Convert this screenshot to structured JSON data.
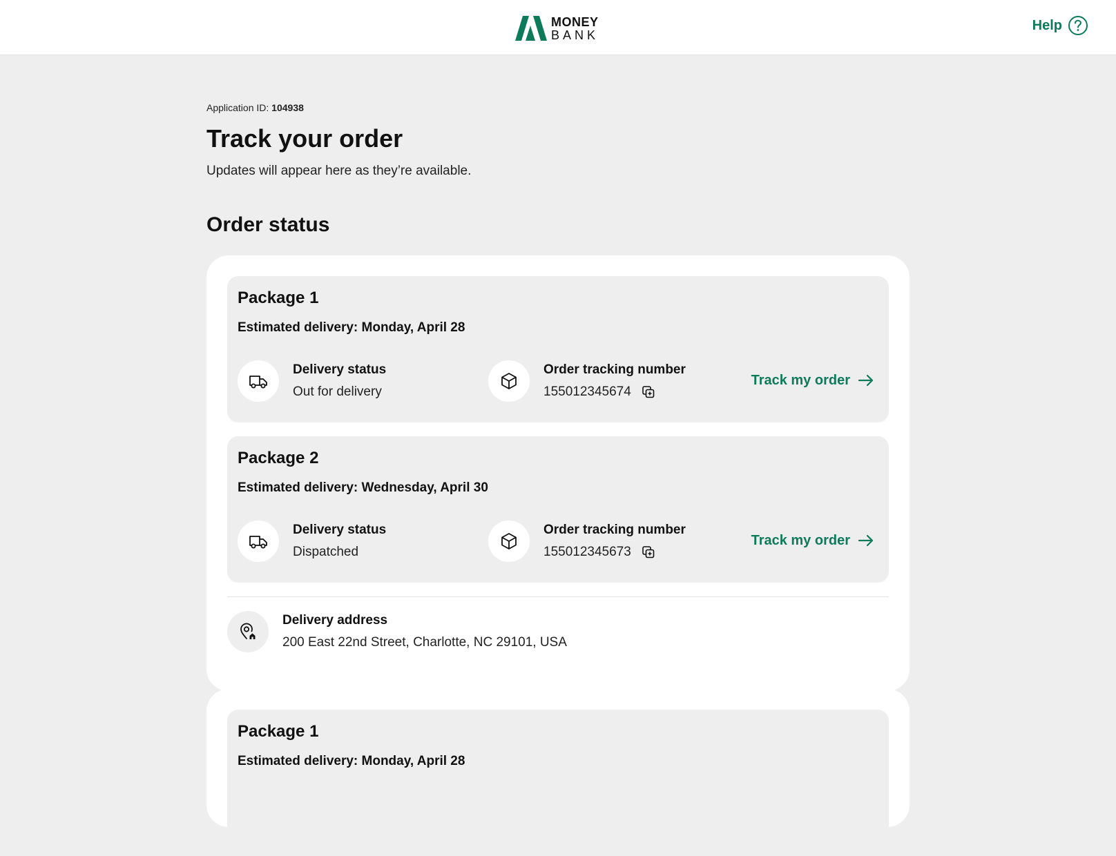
{
  "header": {
    "logo_line1": "MONEY",
    "logo_line2": "BANK",
    "help_label": "Help",
    "help_icon": "question-circle-icon",
    "brand_color": "#0d7a5a"
  },
  "application": {
    "id_label": "Application ID:",
    "id_value": "104938"
  },
  "page": {
    "title": "Track your order",
    "subtitle": "Updates will appear here as they’re available.",
    "section_title": "Order status"
  },
  "orders": [
    {
      "packages": [
        {
          "title": "Package 1",
          "eta": "Estimated delivery: Monday, April 28",
          "status_label": "Delivery status",
          "status_value": "Out for delivery",
          "tracking_label": "Order tracking number",
          "tracking_value": "155012345674",
          "track_link": "Track my order"
        },
        {
          "title": "Package 2",
          "eta": "Estimated delivery: Wednesday, April 30",
          "status_label": "Delivery status",
          "status_value": "Dispatched",
          "tracking_label": "Order tracking number",
          "tracking_value": "155012345673",
          "track_link": "Track my order"
        }
      ],
      "address_label": "Delivery address",
      "address_value": "200 East 22nd Street, Charlotte, NC 29101, USA"
    },
    {
      "packages": [
        {
          "title": "Package 1",
          "eta": "Estimated delivery: Monday, April 28"
        }
      ]
    }
  ]
}
